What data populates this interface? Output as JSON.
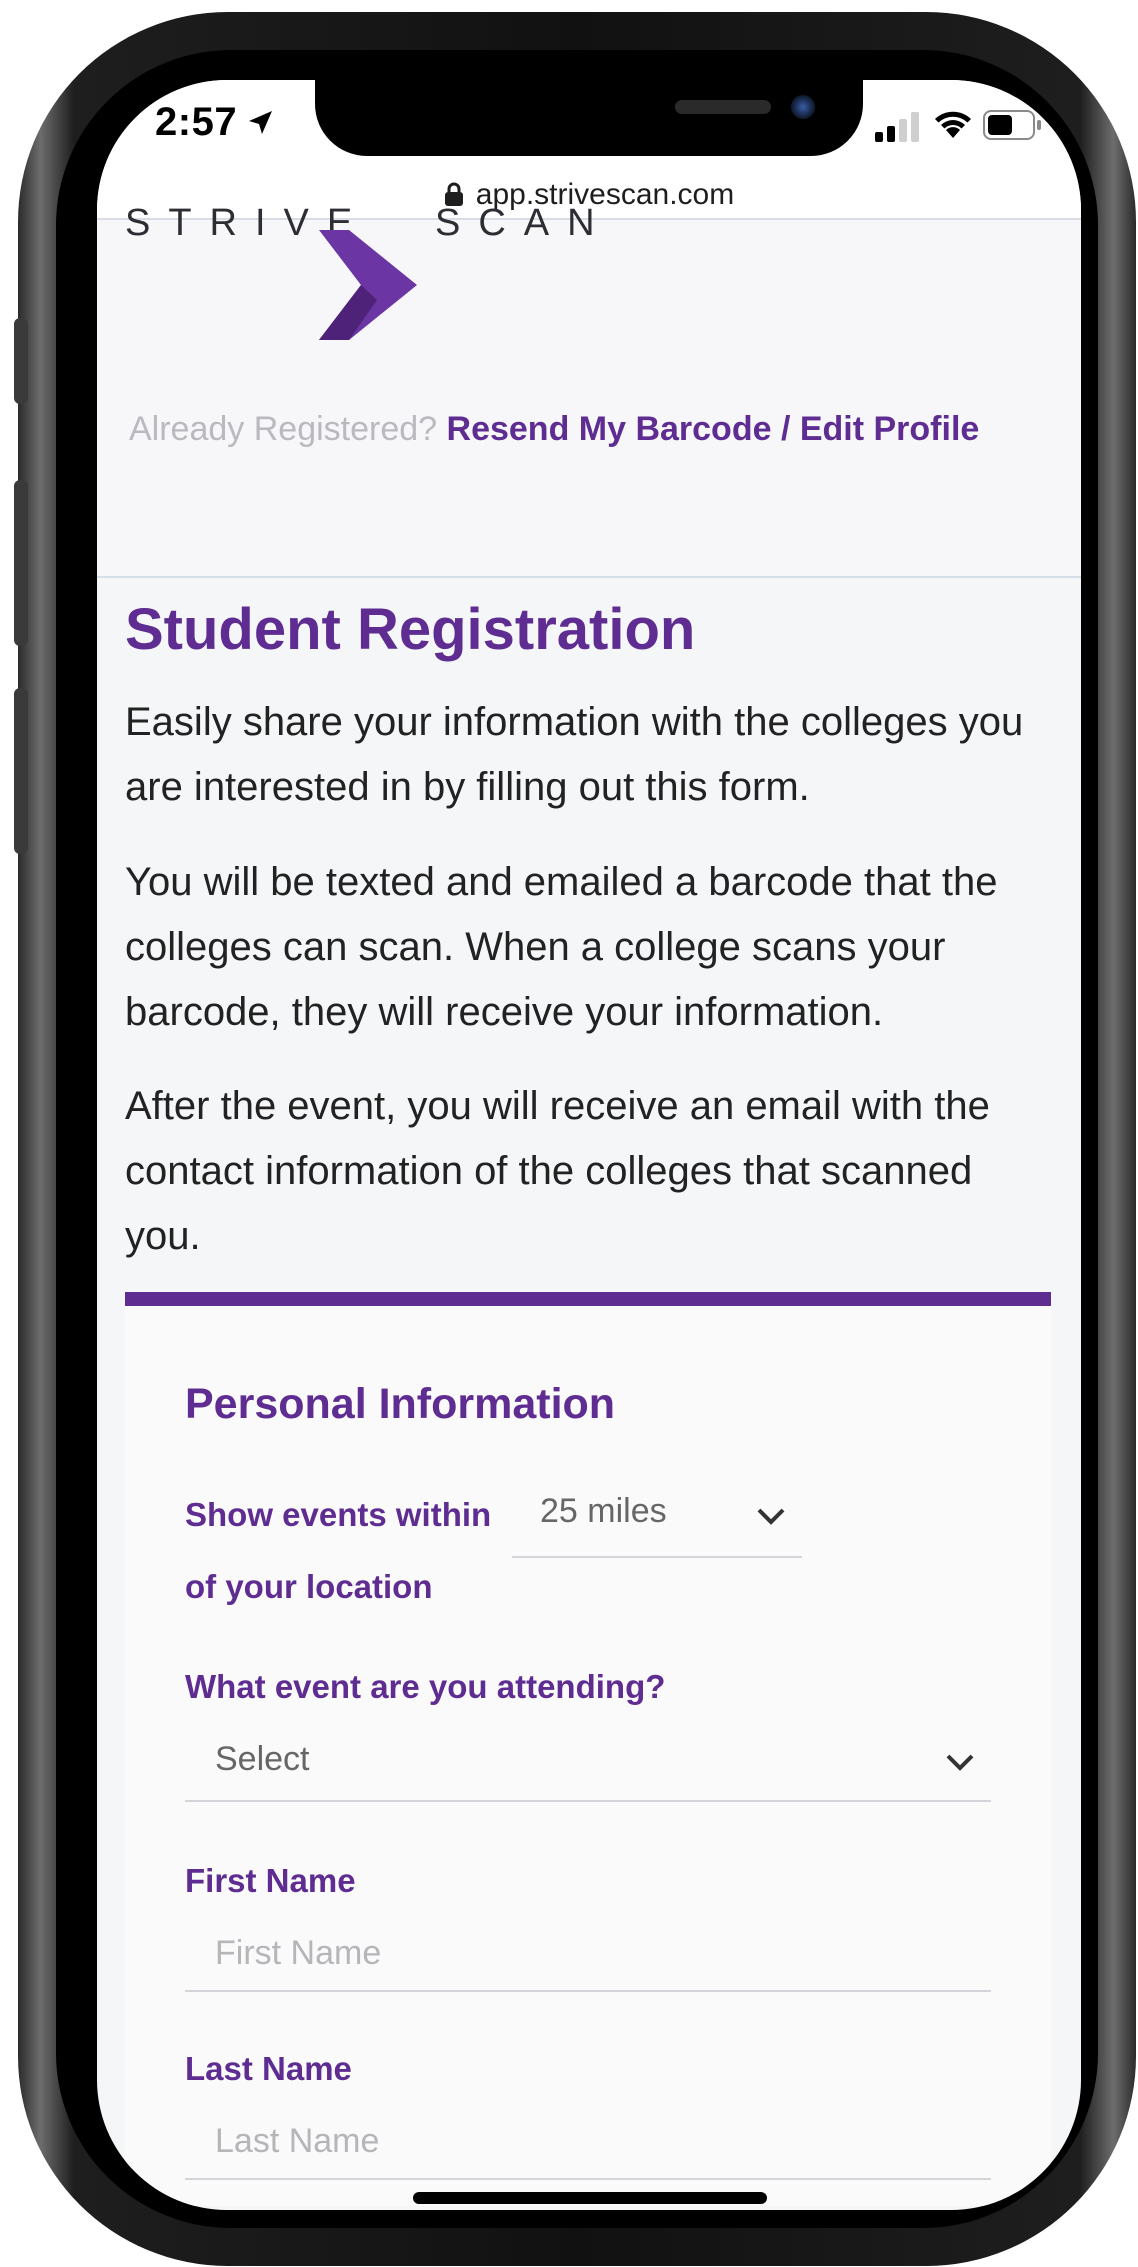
{
  "status_bar": {
    "time": "2:57",
    "url": "app.strivescan.com"
  },
  "header": {
    "logo_left": "STRIVE",
    "logo_right": "SCAN",
    "already_registered": "Already Registered?",
    "resend_link": "Resend My Barcode / Edit Profile"
  },
  "main": {
    "title": "Student Registration",
    "paragraphs": [
      "Easily share your information with the colleges you are interested in by filling out this form.",
      "You will be texted and emailed a barcode that the colleges can scan. When a college scans your barcode, they will receive your information.",
      "After the event, you will receive an email with the contact information of the colleges that scanned you."
    ]
  },
  "form": {
    "section_title": "Personal Information",
    "distance_label_1": "Show events within",
    "distance_label_2": "of your location",
    "distance_value": "25 miles",
    "event_label": "What event are you attending?",
    "event_value": "Select",
    "first_name_label": "First Name",
    "first_name_placeholder": "First Name",
    "last_name_label": "Last Name",
    "last_name_placeholder": "Last Name"
  },
  "colors": {
    "accent": "#5f2d91",
    "background": "#f5f6f8"
  }
}
